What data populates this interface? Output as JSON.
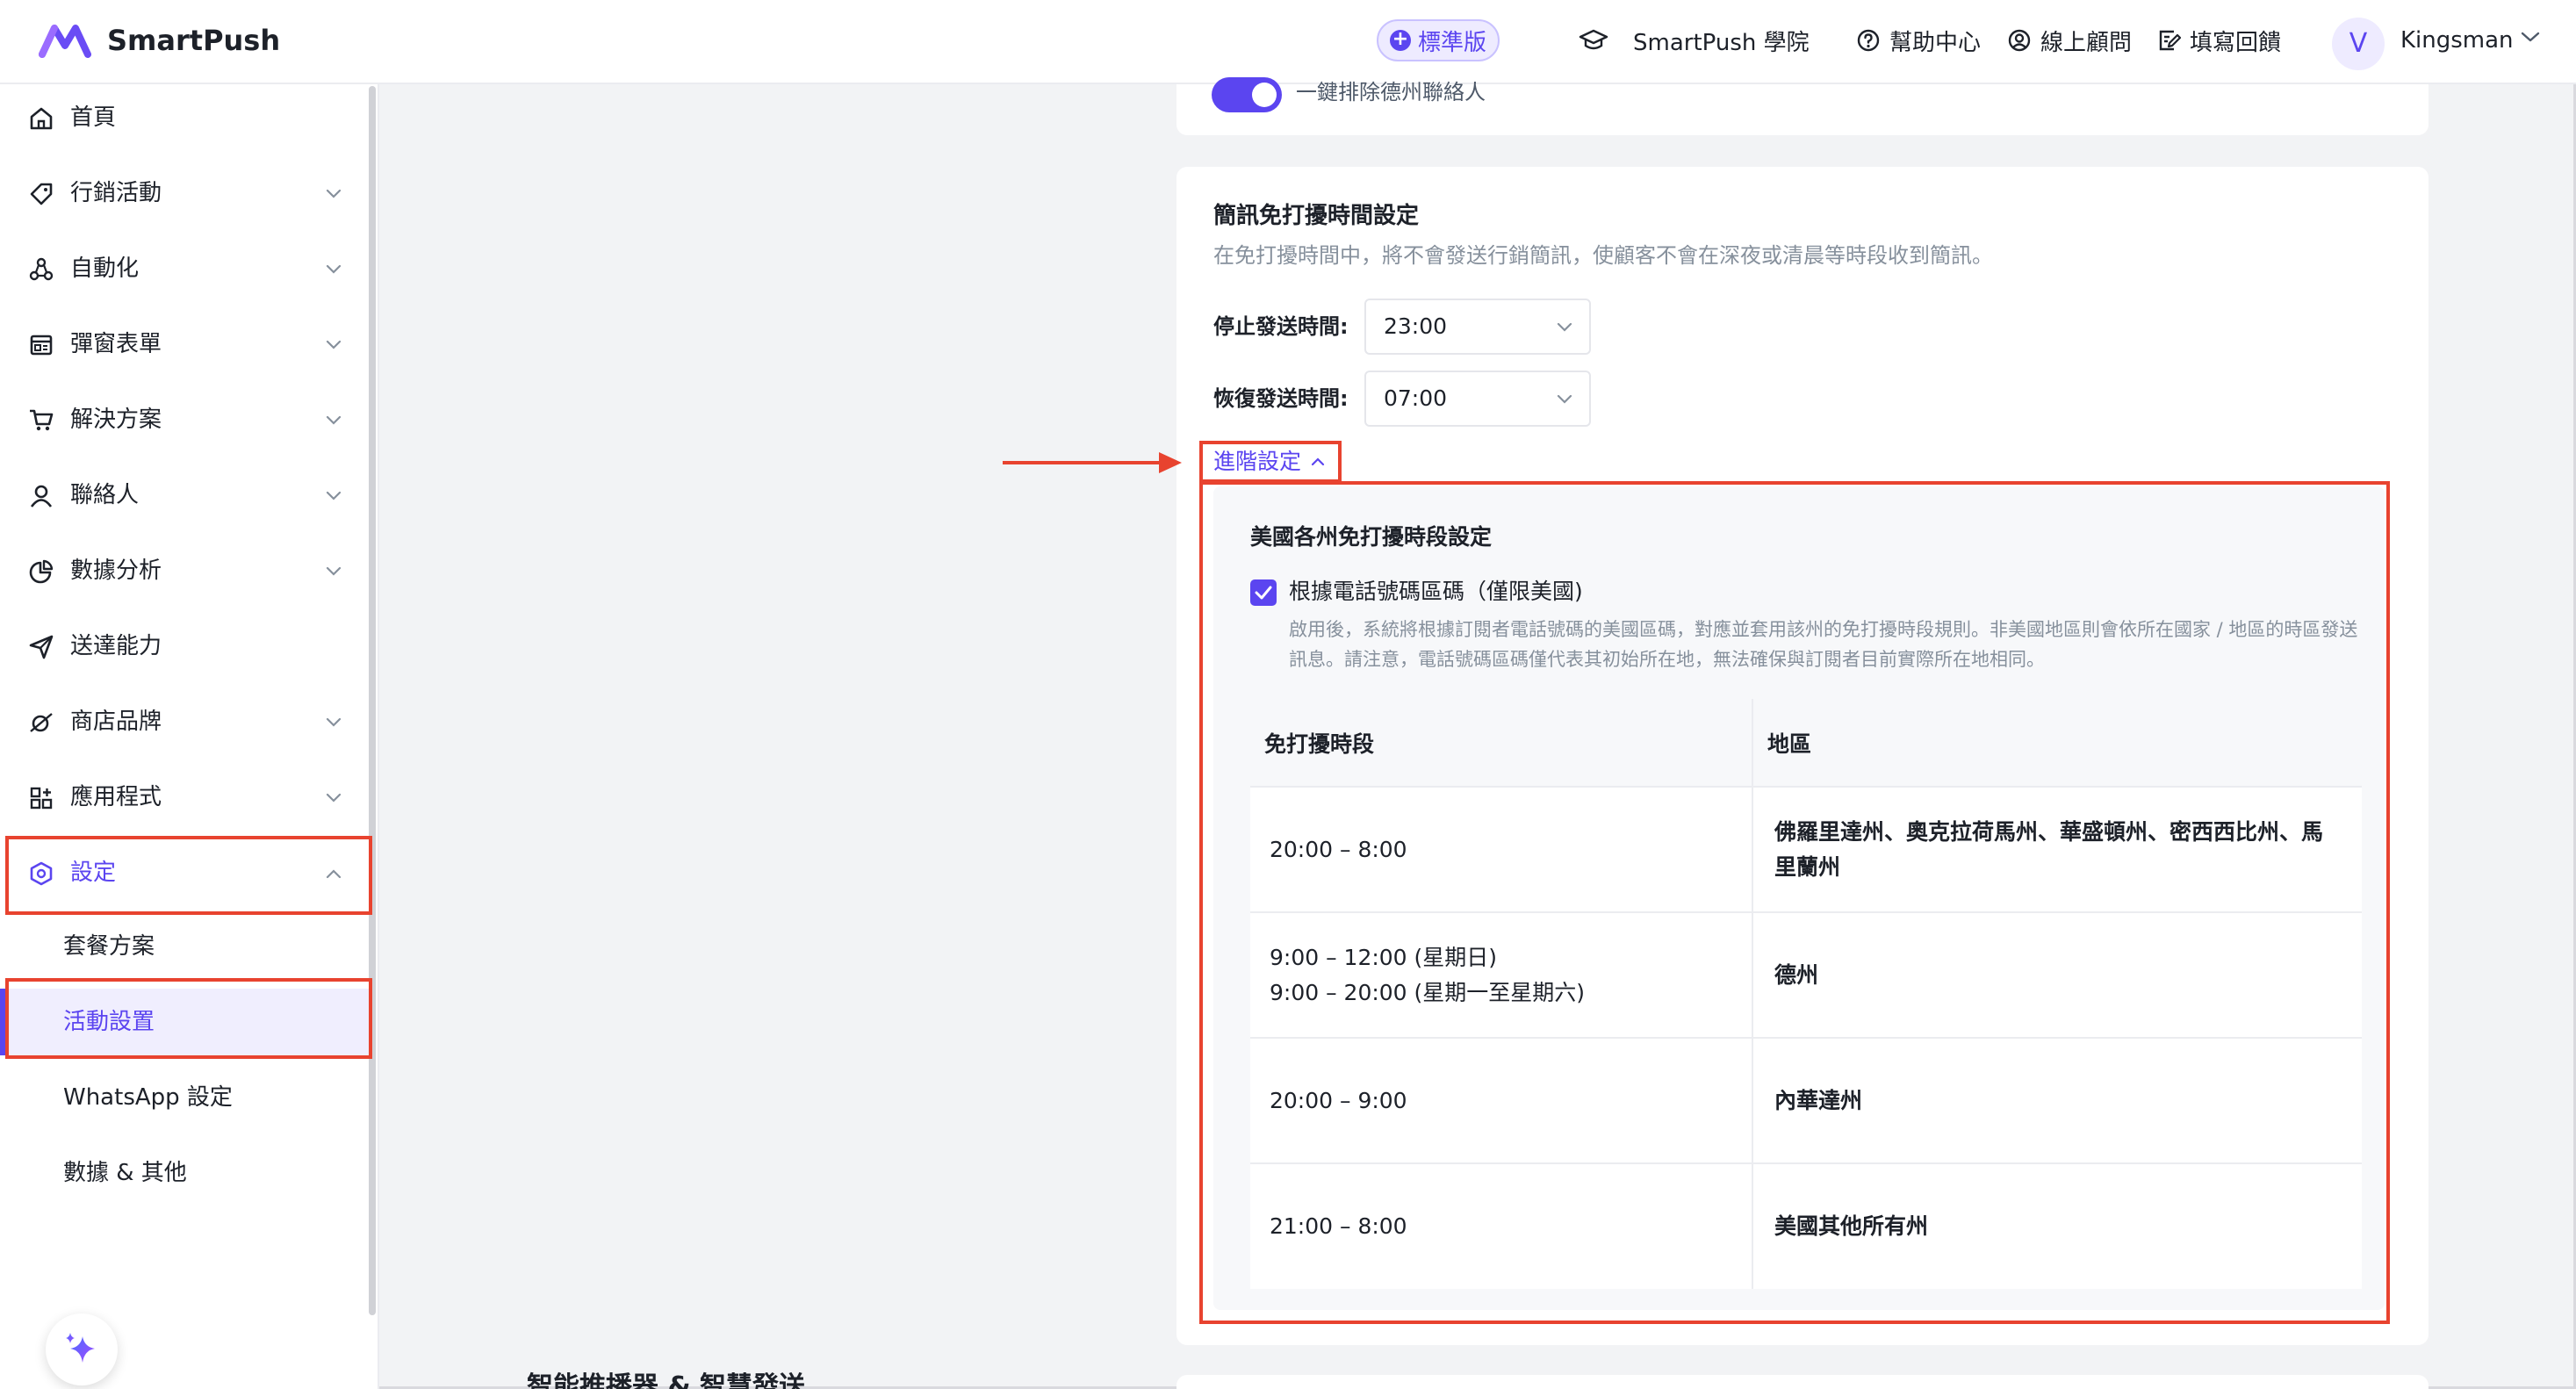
{
  "header": {
    "brand": "SmartPush",
    "plan_badge": "標準版",
    "academy": "SmartPush 學院",
    "help_center": "幫助中心",
    "online_advisor": "線上顧問",
    "feedback": "填寫回饋",
    "avatar_initial": "V",
    "username": "Kingsman"
  },
  "sidebar": {
    "items": [
      {
        "label": "首頁"
      },
      {
        "label": "行銷活動"
      },
      {
        "label": "自動化"
      },
      {
        "label": "彈窗表單"
      },
      {
        "label": "解決方案"
      },
      {
        "label": "聯絡人"
      },
      {
        "label": "數據分析"
      },
      {
        "label": "送達能力"
      },
      {
        "label": "商店品牌"
      },
      {
        "label": "應用程式"
      },
      {
        "label": "設定"
      }
    ],
    "sub_items": [
      {
        "label": "套餐方案"
      },
      {
        "label": "活動設置"
      },
      {
        "label": "WhatsApp 設定"
      },
      {
        "label": "數據 & 其他"
      }
    ]
  },
  "top_card": {
    "toggle_label": "一鍵排除德州聯絡人"
  },
  "quiet_hours": {
    "title": "簡訊免打擾時間設定",
    "description": "在免打擾時間中，將不會發送行銷簡訊，使顧客不會在深夜或清晨等時段收到簡訊。",
    "stop_label": "停止發送時間:",
    "stop_value": "23:00",
    "resume_label": "恢復發送時間:",
    "resume_value": "07:00",
    "advanced_label": "進階設定"
  },
  "advanced": {
    "title": "美國各州免打擾時段設定",
    "checkbox_label": "根據電話號碼區碼（僅限美國)",
    "checkbox_checked": true,
    "help_text": "啟用後，系統將根據訂閱者電話號碼的美國區碼，對應並套用該州的免打擾時段規則。非美國地區則會依所在國家 / 地區的時區發送訊息。請注意，電話號碼區碼僅代表其初始所在地，無法確保與訂閱者目前實際所在地相同。",
    "table": {
      "headers": [
        "免打擾時段",
        "地區"
      ],
      "rows": [
        {
          "time": [
            "20:00 – 8:00"
          ],
          "region": "佛羅里達州、奧克拉荷馬州、華盛頓州、密西西比州、馬里蘭州"
        },
        {
          "time": [
            "9:00 – 12:00 (星期日)",
            "9:00 – 20:00 (星期一至星期六)"
          ],
          "region": "德州"
        },
        {
          "time": [
            "20:00 – 9:00"
          ],
          "region": "內華達州"
        },
        {
          "time": [
            "21:00 – 8:00"
          ],
          "region": "美國其他所有州"
        }
      ]
    }
  },
  "next_section_title": "智能推播器 & 智慧發送",
  "colors": {
    "accent": "#5b45f0",
    "annotation": "#e8432f",
    "background": "#f2f3f5"
  }
}
